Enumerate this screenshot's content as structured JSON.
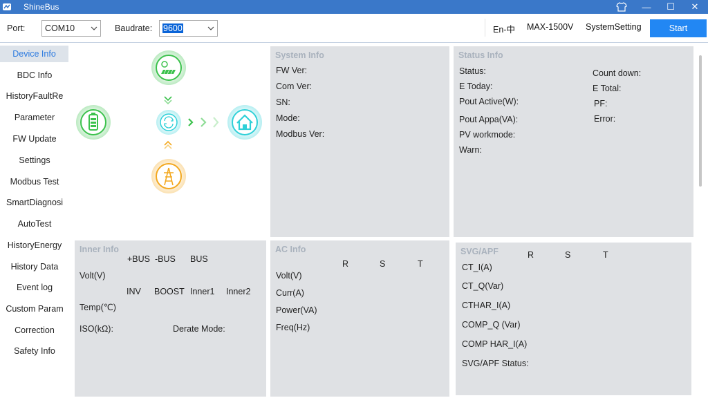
{
  "window": {
    "title": "ShineBus",
    "minimize": "—",
    "maximize": "☐",
    "close": "✕"
  },
  "toolbar": {
    "port_label": "Port:",
    "port_value": "COM10",
    "baud_label": "Baudrate:",
    "baud_value": "9600",
    "language": "En-中",
    "model": "MAX-1500V",
    "system_setting": "SystemSetting",
    "start": "Start"
  },
  "sidebar": {
    "items": [
      "Device Info",
      "BDC Info",
      "HistoryFaultRe",
      "Parameter",
      "FW Update",
      "Settings",
      "Modbus Test",
      "SmartDiagnosi",
      "AutoTest",
      "HistoryEnergy",
      "History Data",
      "Event log",
      "Custom Param",
      "Correction",
      "Safety Info"
    ],
    "active_index": 0
  },
  "diagram": {
    "icons": [
      "solar-panel-icon",
      "battery-icon",
      "inverter-icon",
      "home-icon",
      "grid-tower-icon"
    ],
    "colors": {
      "green": "#3cc24d",
      "cyan": "#2fd0d8",
      "orange": "#f3a81f"
    }
  },
  "system_info": {
    "title": "System Info",
    "fields": [
      "FW Ver:",
      "Com Ver:",
      "SN:",
      "Mode:",
      "Modbus Ver:"
    ]
  },
  "status_info": {
    "title": "Status Info",
    "left_fields": [
      "Status:",
      "E Today:",
      "Pout Active(W):",
      "Pout Appa(VA):",
      "PV workmode:",
      "Warn:"
    ],
    "right_fields": [
      "Count down:",
      "E Total:",
      "PF:",
      "Error:"
    ]
  },
  "inner_info": {
    "title": "Inner Info",
    "bus_headers": [
      "+BUS",
      "-BUS",
      "BUS"
    ],
    "volt_label": "Volt(V)",
    "temp_headers": [
      "INV",
      "BOOST",
      "Inner1",
      "Inner2"
    ],
    "temp_label": "Temp(℃)",
    "iso_label": "ISO(kΩ):",
    "derate_label": "Derate Mode:"
  },
  "ac_info": {
    "title": "AC Info",
    "phases": [
      "R",
      "S",
      "T"
    ],
    "rows": [
      "Volt(V)",
      "Curr(A)",
      "Power(VA)",
      "Freq(Hz)"
    ]
  },
  "svg_apf": {
    "title": "SVG/APF",
    "phases": [
      "R",
      "S",
      "T"
    ],
    "rows": [
      "CT_I(A)",
      "CT_Q(Var)",
      "CTHAR_I(A)",
      "COMP_Q (Var)",
      "COMP HAR_I(A)",
      "SVG/APF Status:"
    ]
  }
}
